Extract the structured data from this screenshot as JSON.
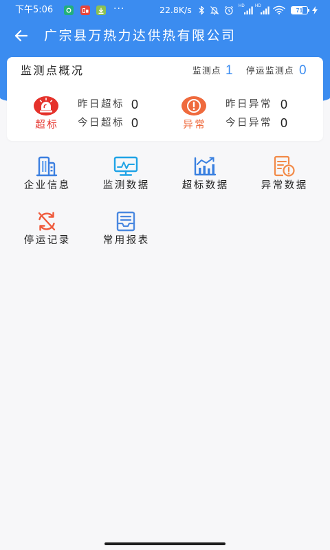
{
  "status_bar": {
    "time": "下午5:06",
    "notification_icons": [
      "app-notification-icon",
      "app-notification-icon",
      "download-notification-icon"
    ],
    "more": "···",
    "net_speed": "22.8K/s",
    "system_icons": [
      "bluetooth-icon",
      "mute-icon",
      "alarm-clock-icon",
      "cellular-signal-icon",
      "cellular-signal-icon",
      "wifi-icon",
      "battery-icon",
      "charging-icon"
    ],
    "signal_tag": "HD",
    "battery_level": 71
  },
  "header": {
    "back_icon": "arrow-left-icon",
    "title": "广宗县万热力达供热有限公司"
  },
  "overview": {
    "title": "监测点概况",
    "monitor_points": {
      "label": "监测点",
      "value": 1
    },
    "stopped_points": {
      "label": "停运监测点",
      "value": 0
    },
    "exceed": {
      "icon": "alarm-siren-icon",
      "label": "超标",
      "yesterday_label": "昨日超标",
      "yesterday_value": 0,
      "today_label": "今日超标",
      "today_value": 0
    },
    "abnormal": {
      "icon": "exclamation-circle-icon",
      "label": "异常",
      "yesterday_label": "昨日异常",
      "yesterday_value": 0,
      "today_label": "今日异常",
      "today_value": 0
    }
  },
  "menu": {
    "items": [
      {
        "label": "企业信息",
        "icon": "building-icon"
      },
      {
        "label": "监测数据",
        "icon": "monitor-icon"
      },
      {
        "label": "超标数据",
        "icon": "bar-chart-icon"
      },
      {
        "label": "异常数据",
        "icon": "warning-document-icon"
      },
      {
        "label": "停运记录",
        "icon": "stop-cycle-icon"
      },
      {
        "label": "常用报表",
        "icon": "report-tray-icon"
      }
    ]
  },
  "colors": {
    "primary": "#3b8cf0",
    "exceed_red": "#e5322b",
    "abnormal_orange": "#ef6a3d",
    "background": "#f7f7f9"
  }
}
